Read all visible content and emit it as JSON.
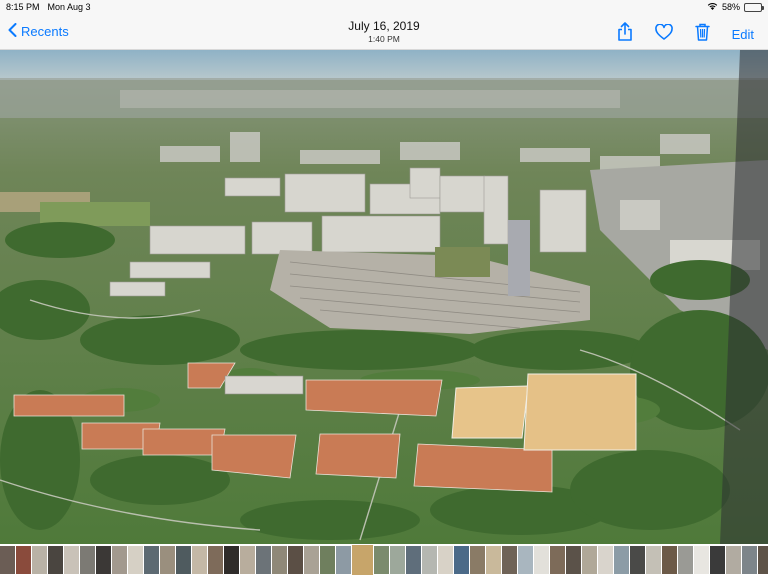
{
  "status": {
    "time": "8:15 PM",
    "date": "Mon Aug 3",
    "battery": "58%",
    "battery_level": 0.58
  },
  "nav": {
    "back_label": "Recents",
    "title_date": "July 16, 2019",
    "title_time": "1:40 PM",
    "edit_label": "Edit",
    "icons": [
      "chevron-left-icon",
      "share-icon",
      "heart-icon",
      "trash-icon"
    ]
  },
  "thumbnails": {
    "colors": [
      "#6b5d55",
      "#8a4b3c",
      "#b9b2a6",
      "#4a4540",
      "#c9c2b8",
      "#7c7a74",
      "#3b3836",
      "#a2998e",
      "#d6d0c5",
      "#5d6a72",
      "#9a8f7e",
      "#4f5b5f",
      "#c4b8a6",
      "#7e6b5a",
      "#2f2c2a",
      "#b8ad9d",
      "#6c7378",
      "#8f8878",
      "#5b4f45",
      "#a9a295",
      "#6f7f5e",
      "#8d9aa4",
      "#c7a56a",
      "#7b8b6d",
      "#9da89b",
      "#5f6e7b",
      "#b5b7b1",
      "#d8d2c7",
      "#4b6a88",
      "#8a7b66",
      "#c9b99b",
      "#6f6357",
      "#a9b6bf",
      "#e2e0da",
      "#7d6b59",
      "#5b5249",
      "#b0a898",
      "#d9d4cc",
      "#8c9ca6",
      "#4a4a48",
      "#c4c0b6",
      "#6c5a48",
      "#9a9a95",
      "#e8e6e1",
      "#3a3a3a",
      "#b1aba1",
      "#7d858a",
      "#5e5348"
    ],
    "current_index": 22
  }
}
